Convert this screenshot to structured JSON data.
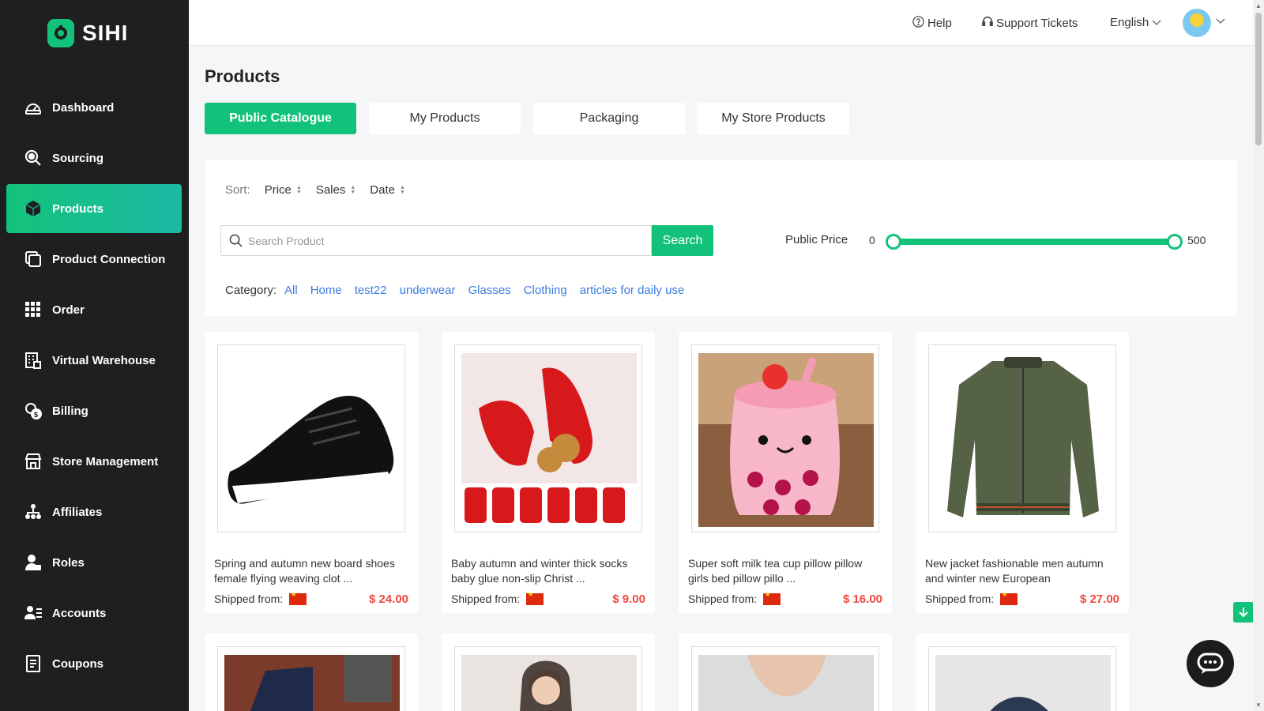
{
  "brand": {
    "name": "SIHI"
  },
  "sidebar": {
    "items": [
      {
        "label": "Dashboard",
        "icon": "dashboard-icon"
      },
      {
        "label": "Sourcing",
        "icon": "search-icon"
      },
      {
        "label": "Products",
        "icon": "box-icon",
        "active": true
      },
      {
        "label": "Product Connection",
        "icon": "link-icon"
      },
      {
        "label": "Order",
        "icon": "grid-icon"
      },
      {
        "label": "Virtual Warehouse",
        "icon": "warehouse-icon"
      },
      {
        "label": "Billing",
        "icon": "billing-icon"
      },
      {
        "label": "Store Management",
        "icon": "store-icon"
      },
      {
        "label": "Affiliates",
        "icon": "affiliates-icon"
      },
      {
        "label": "Roles",
        "icon": "roles-icon"
      },
      {
        "label": "Accounts",
        "icon": "accounts-icon"
      },
      {
        "label": "Coupons",
        "icon": "coupon-icon"
      }
    ]
  },
  "header": {
    "help": "Help",
    "support": "Support Tickets",
    "language": "English"
  },
  "page": {
    "title": "Products",
    "tabs": [
      "Public Catalogue",
      "My Products",
      "Packaging",
      "My Store Products"
    ]
  },
  "filters": {
    "sort_label": "Sort:",
    "sort_options": [
      "Price",
      "Sales",
      "Date"
    ],
    "search_placeholder": "Search Product",
    "search_button": "Search",
    "price_label": "Public Price",
    "price_min": "0",
    "price_max": "500",
    "category_label": "Category:",
    "categories": [
      "All",
      "Home",
      "test22",
      "underwear",
      "Glasses",
      "Clothing",
      "articles for daily use"
    ]
  },
  "products": [
    {
      "title": "Spring and autumn new board shoes female flying weaving clot ...",
      "ship_label": "Shipped from:",
      "price": "$ 24.00"
    },
    {
      "title": "Baby autumn and winter thick socks baby glue non-slip Christ ...",
      "ship_label": "Shipped from:",
      "price": "$ 9.00"
    },
    {
      "title": "Super soft milk tea cup pillow pillow girls bed pillow pillo ...",
      "ship_label": "Shipped from:",
      "price": "$ 16.00"
    },
    {
      "title": "New jacket fashionable men autumn and winter new European",
      "ship_label": "Shipped from:",
      "price": "$ 27.00"
    }
  ],
  "colors": {
    "accent": "#13c27a",
    "sidebar_bg": "#1e1f1f",
    "price": "#f0493e",
    "link": "#3b7ce0"
  }
}
